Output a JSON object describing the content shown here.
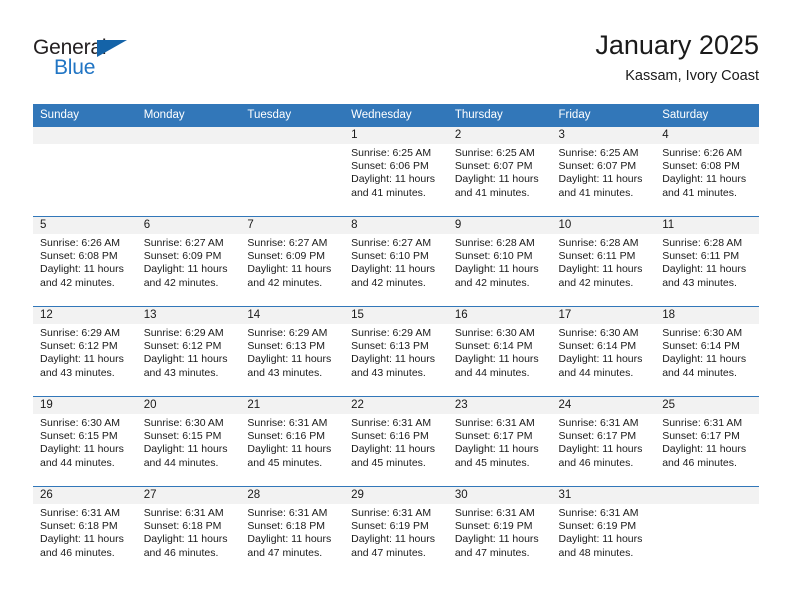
{
  "brand": {
    "name_top": "General",
    "name_bottom": "Blue",
    "accent_color": "#1463a8",
    "blue_text_color": "#2175c4"
  },
  "header": {
    "month_title": "January 2025",
    "location": "Kassam, Ivory Coast",
    "header_bg_color": "#3277b9",
    "daynum_band_color": "#f2f2f2"
  },
  "weekday_headers": [
    "Sunday",
    "Monday",
    "Tuesday",
    "Wednesday",
    "Thursday",
    "Friday",
    "Saturday"
  ],
  "labels": {
    "sunrise_prefix": "Sunrise:",
    "sunset_prefix": "Sunset:",
    "daylight_prefix": "Daylight:"
  },
  "weeks": [
    [
      {
        "day": "",
        "sunrise": "",
        "sunset": "",
        "daylight_line1": "",
        "daylight_line2": ""
      },
      {
        "day": "",
        "sunrise": "",
        "sunset": "",
        "daylight_line1": "",
        "daylight_line2": ""
      },
      {
        "day": "",
        "sunrise": "",
        "sunset": "",
        "daylight_line1": "",
        "daylight_line2": ""
      },
      {
        "day": "1",
        "sunrise": "Sunrise: 6:25 AM",
        "sunset": "Sunset: 6:06 PM",
        "daylight_line1": "Daylight: 11 hours",
        "daylight_line2": "and 41 minutes."
      },
      {
        "day": "2",
        "sunrise": "Sunrise: 6:25 AM",
        "sunset": "Sunset: 6:07 PM",
        "daylight_line1": "Daylight: 11 hours",
        "daylight_line2": "and 41 minutes."
      },
      {
        "day": "3",
        "sunrise": "Sunrise: 6:25 AM",
        "sunset": "Sunset: 6:07 PM",
        "daylight_line1": "Daylight: 11 hours",
        "daylight_line2": "and 41 minutes."
      },
      {
        "day": "4",
        "sunrise": "Sunrise: 6:26 AM",
        "sunset": "Sunset: 6:08 PM",
        "daylight_line1": "Daylight: 11 hours",
        "daylight_line2": "and 41 minutes."
      }
    ],
    [
      {
        "day": "5",
        "sunrise": "Sunrise: 6:26 AM",
        "sunset": "Sunset: 6:08 PM",
        "daylight_line1": "Daylight: 11 hours",
        "daylight_line2": "and 42 minutes."
      },
      {
        "day": "6",
        "sunrise": "Sunrise: 6:27 AM",
        "sunset": "Sunset: 6:09 PM",
        "daylight_line1": "Daylight: 11 hours",
        "daylight_line2": "and 42 minutes."
      },
      {
        "day": "7",
        "sunrise": "Sunrise: 6:27 AM",
        "sunset": "Sunset: 6:09 PM",
        "daylight_line1": "Daylight: 11 hours",
        "daylight_line2": "and 42 minutes."
      },
      {
        "day": "8",
        "sunrise": "Sunrise: 6:27 AM",
        "sunset": "Sunset: 6:10 PM",
        "daylight_line1": "Daylight: 11 hours",
        "daylight_line2": "and 42 minutes."
      },
      {
        "day": "9",
        "sunrise": "Sunrise: 6:28 AM",
        "sunset": "Sunset: 6:10 PM",
        "daylight_line1": "Daylight: 11 hours",
        "daylight_line2": "and 42 minutes."
      },
      {
        "day": "10",
        "sunrise": "Sunrise: 6:28 AM",
        "sunset": "Sunset: 6:11 PM",
        "daylight_line1": "Daylight: 11 hours",
        "daylight_line2": "and 42 minutes."
      },
      {
        "day": "11",
        "sunrise": "Sunrise: 6:28 AM",
        "sunset": "Sunset: 6:11 PM",
        "daylight_line1": "Daylight: 11 hours",
        "daylight_line2": "and 43 minutes."
      }
    ],
    [
      {
        "day": "12",
        "sunrise": "Sunrise: 6:29 AM",
        "sunset": "Sunset: 6:12 PM",
        "daylight_line1": "Daylight: 11 hours",
        "daylight_line2": "and 43 minutes."
      },
      {
        "day": "13",
        "sunrise": "Sunrise: 6:29 AM",
        "sunset": "Sunset: 6:12 PM",
        "daylight_line1": "Daylight: 11 hours",
        "daylight_line2": "and 43 minutes."
      },
      {
        "day": "14",
        "sunrise": "Sunrise: 6:29 AM",
        "sunset": "Sunset: 6:13 PM",
        "daylight_line1": "Daylight: 11 hours",
        "daylight_line2": "and 43 minutes."
      },
      {
        "day": "15",
        "sunrise": "Sunrise: 6:29 AM",
        "sunset": "Sunset: 6:13 PM",
        "daylight_line1": "Daylight: 11 hours",
        "daylight_line2": "and 43 minutes."
      },
      {
        "day": "16",
        "sunrise": "Sunrise: 6:30 AM",
        "sunset": "Sunset: 6:14 PM",
        "daylight_line1": "Daylight: 11 hours",
        "daylight_line2": "and 44 minutes."
      },
      {
        "day": "17",
        "sunrise": "Sunrise: 6:30 AM",
        "sunset": "Sunset: 6:14 PM",
        "daylight_line1": "Daylight: 11 hours",
        "daylight_line2": "and 44 minutes."
      },
      {
        "day": "18",
        "sunrise": "Sunrise: 6:30 AM",
        "sunset": "Sunset: 6:14 PM",
        "daylight_line1": "Daylight: 11 hours",
        "daylight_line2": "and 44 minutes."
      }
    ],
    [
      {
        "day": "19",
        "sunrise": "Sunrise: 6:30 AM",
        "sunset": "Sunset: 6:15 PM",
        "daylight_line1": "Daylight: 11 hours",
        "daylight_line2": "and 44 minutes."
      },
      {
        "day": "20",
        "sunrise": "Sunrise: 6:30 AM",
        "sunset": "Sunset: 6:15 PM",
        "daylight_line1": "Daylight: 11 hours",
        "daylight_line2": "and 44 minutes."
      },
      {
        "day": "21",
        "sunrise": "Sunrise: 6:31 AM",
        "sunset": "Sunset: 6:16 PM",
        "daylight_line1": "Daylight: 11 hours",
        "daylight_line2": "and 45 minutes."
      },
      {
        "day": "22",
        "sunrise": "Sunrise: 6:31 AM",
        "sunset": "Sunset: 6:16 PM",
        "daylight_line1": "Daylight: 11 hours",
        "daylight_line2": "and 45 minutes."
      },
      {
        "day": "23",
        "sunrise": "Sunrise: 6:31 AM",
        "sunset": "Sunset: 6:17 PM",
        "daylight_line1": "Daylight: 11 hours",
        "daylight_line2": "and 45 minutes."
      },
      {
        "day": "24",
        "sunrise": "Sunrise: 6:31 AM",
        "sunset": "Sunset: 6:17 PM",
        "daylight_line1": "Daylight: 11 hours",
        "daylight_line2": "and 46 minutes."
      },
      {
        "day": "25",
        "sunrise": "Sunrise: 6:31 AM",
        "sunset": "Sunset: 6:17 PM",
        "daylight_line1": "Daylight: 11 hours",
        "daylight_line2": "and 46 minutes."
      }
    ],
    [
      {
        "day": "26",
        "sunrise": "Sunrise: 6:31 AM",
        "sunset": "Sunset: 6:18 PM",
        "daylight_line1": "Daylight: 11 hours",
        "daylight_line2": "and 46 minutes."
      },
      {
        "day": "27",
        "sunrise": "Sunrise: 6:31 AM",
        "sunset": "Sunset: 6:18 PM",
        "daylight_line1": "Daylight: 11 hours",
        "daylight_line2": "and 46 minutes."
      },
      {
        "day": "28",
        "sunrise": "Sunrise: 6:31 AM",
        "sunset": "Sunset: 6:18 PM",
        "daylight_line1": "Daylight: 11 hours",
        "daylight_line2": "and 47 minutes."
      },
      {
        "day": "29",
        "sunrise": "Sunrise: 6:31 AM",
        "sunset": "Sunset: 6:19 PM",
        "daylight_line1": "Daylight: 11 hours",
        "daylight_line2": "and 47 minutes."
      },
      {
        "day": "30",
        "sunrise": "Sunrise: 6:31 AM",
        "sunset": "Sunset: 6:19 PM",
        "daylight_line1": "Daylight: 11 hours",
        "daylight_line2": "and 47 minutes."
      },
      {
        "day": "31",
        "sunrise": "Sunrise: 6:31 AM",
        "sunset": "Sunset: 6:19 PM",
        "daylight_line1": "Daylight: 11 hours",
        "daylight_line2": "and 48 minutes."
      },
      {
        "day": "",
        "sunrise": "",
        "sunset": "",
        "daylight_line1": "",
        "daylight_line2": ""
      }
    ]
  ]
}
